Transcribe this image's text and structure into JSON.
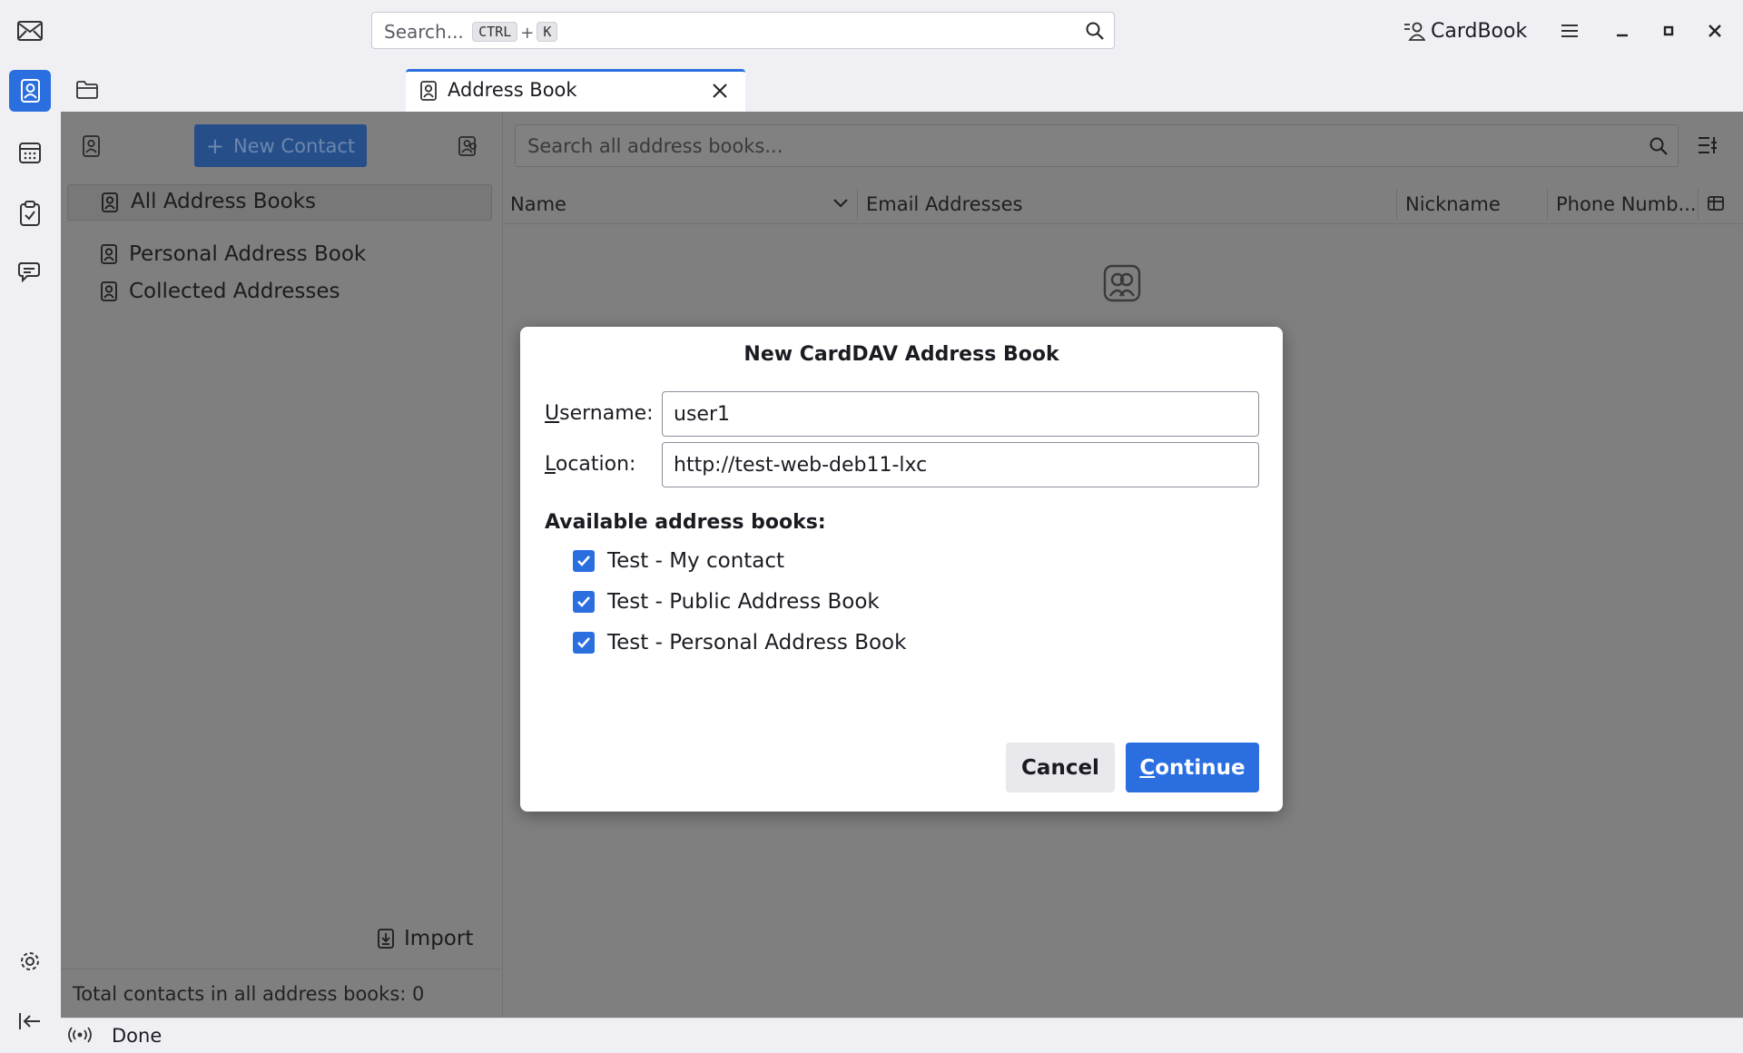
{
  "titlebar": {
    "search_placeholder": "Search...",
    "shortcut_ctrl": "CTRL",
    "shortcut_plus": "+",
    "shortcut_key": "K",
    "cardbook_label": "CardBook"
  },
  "tab": {
    "label": "Address Book"
  },
  "left_pane": {
    "new_contact_label": "New Contact",
    "all_books_label": "All Address Books",
    "books": [
      "Personal Address Book",
      "Collected Addresses"
    ],
    "import_label": "Import",
    "total_text": "Total contacts in all address books: 0"
  },
  "main": {
    "search_placeholder": "Search all address books...",
    "columns": [
      "Name",
      "Email Addresses",
      "Nickname",
      "Phone Numb..."
    ]
  },
  "status": {
    "text": "Done"
  },
  "dialog": {
    "title": "New CardDAV Address Book",
    "username_label_key": "U",
    "username_label_rest": "sername:",
    "username_value": "user1",
    "location_label_key": "L",
    "location_label_rest": "ocation:",
    "location_value": "http://test-web-deb11-lxc",
    "available_label": "Available address books:",
    "books": [
      "Test - My contact",
      "Test - Public Address Book",
      "Test - Personal Address Book"
    ],
    "cancel_label": "Cancel",
    "continue_key": "C",
    "continue_rest": "ontinue"
  },
  "colors": {
    "accent": "#2b6ee0",
    "overlay": "#7f7f7f"
  }
}
